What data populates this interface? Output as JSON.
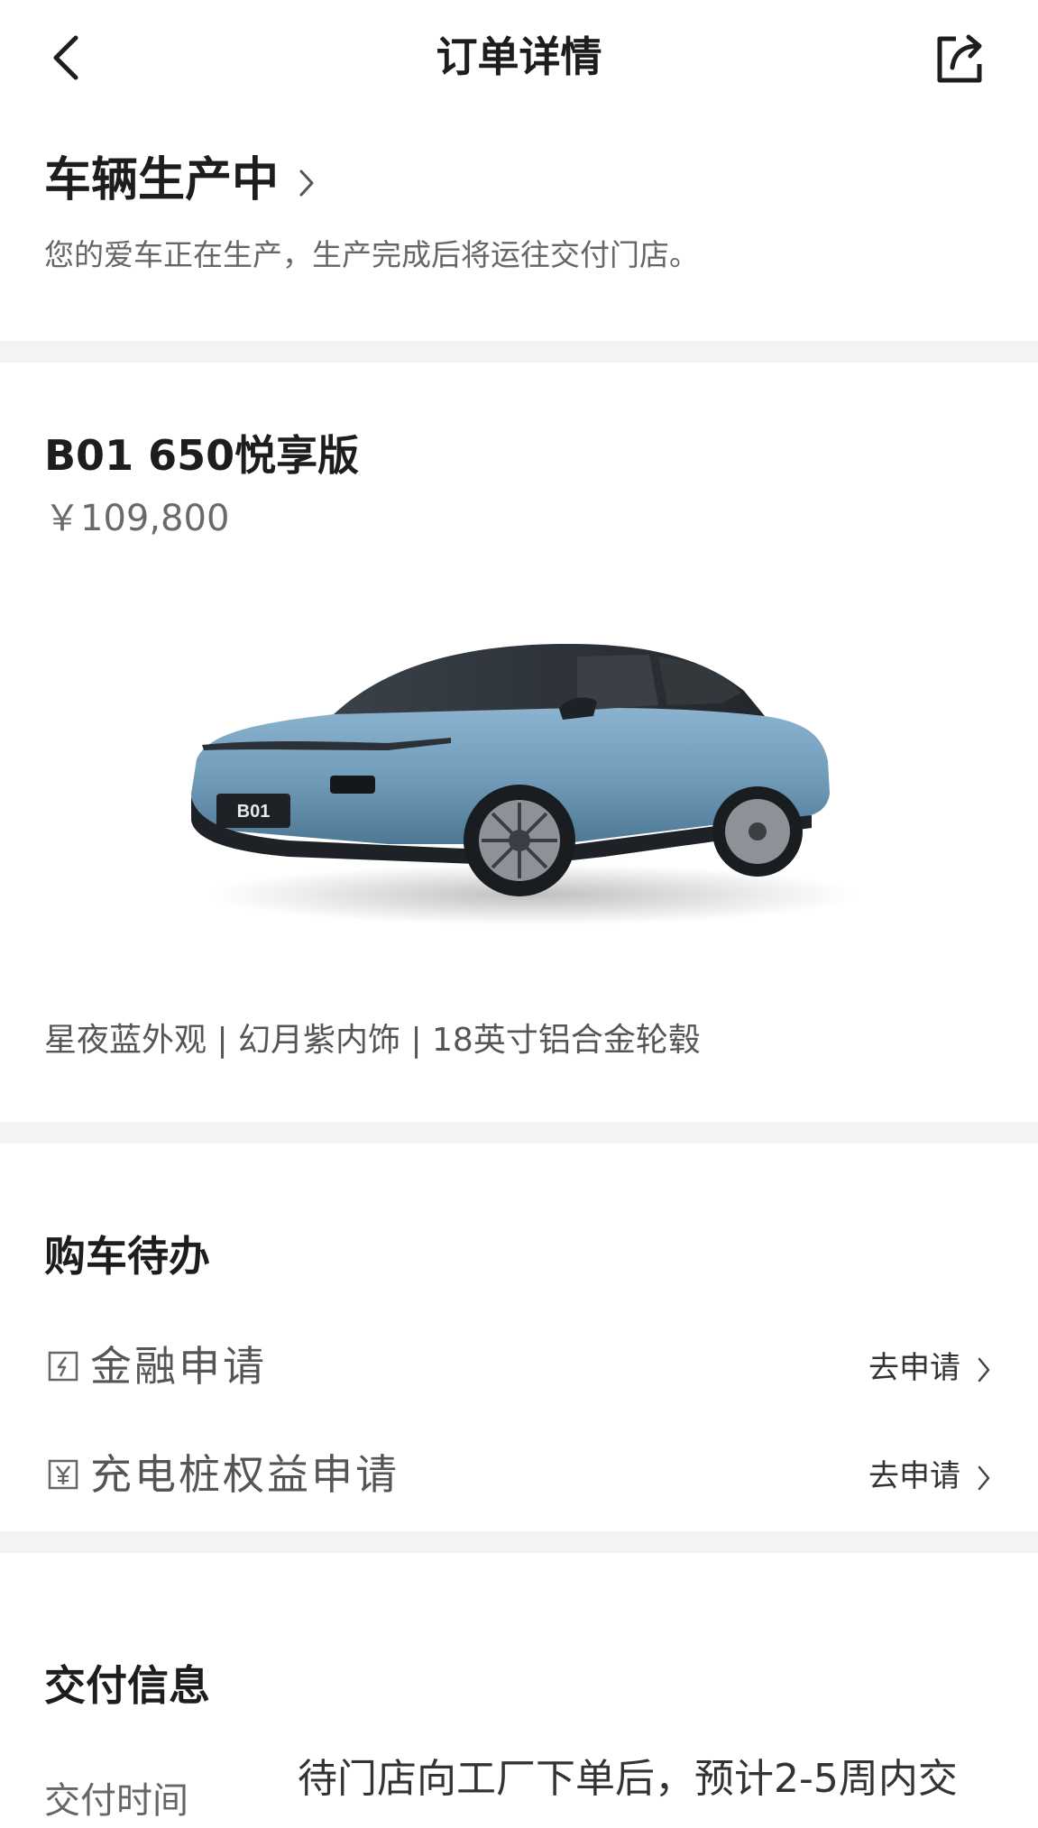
{
  "header": {
    "title": "订单详情",
    "back_icon": "chevron-left-icon",
    "share_icon": "share-icon"
  },
  "status": {
    "title": "车辆生产中",
    "description": "您的爱车正在生产，生产完成后将运往交付门店。"
  },
  "car": {
    "model": "B01 650悦享版",
    "price": "￥109,800",
    "badge_text": "B01",
    "specs": "星夜蓝外观 | 幻月紫内饰 | 18英寸铝合金轮毂",
    "body_color": "#6e9ab8"
  },
  "todo": {
    "title": "购车待办",
    "items": [
      {
        "label": "金融申请",
        "action": "去申请",
        "icon": "finance-icon"
      },
      {
        "label": "充电桩权益申请",
        "action": "去申请",
        "icon": "yuan-icon"
      }
    ]
  },
  "delivery": {
    "title": "交付信息",
    "rows": [
      {
        "label": "交付时间",
        "value": "待门店向工厂下单后，预计2-5周内交"
      }
    ]
  },
  "colors": {
    "divider": "#f3f3f4",
    "text_primary": "#1d1d1d",
    "text_secondary": "#666666"
  }
}
